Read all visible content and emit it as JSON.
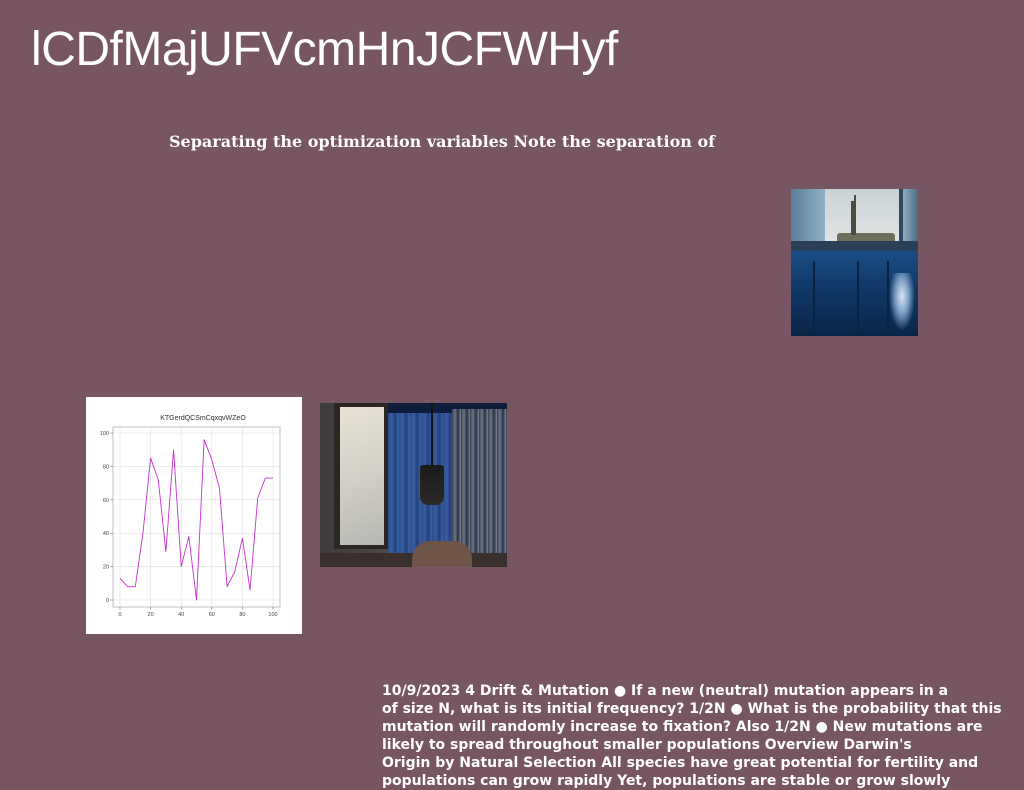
{
  "page": {
    "title": "lCDfMajUFVcmHnJCFWHyf",
    "subtitle": "Separating the optimization variables Note the separation of",
    "body_text": "10/9/2023 4 Drift & Mutation ● If a new (neutral) mutation appears in a\nof size N, what is its initial frequency? 1/2N ● What is the probability that this\nmutation will randomly increase to fixation? Also 1/2N ● New mutations are\nlikely to spread throughout smaller populations Overview Darwin's\nOrigin by Natural Selection All species have great potential for fertility and\npopulations can grow rapidly Yet, populations are stable or grow slowly",
    "background_color": "#775563",
    "text_color": "#ffffff"
  },
  "chart_data": {
    "type": "line",
    "title": "KTGerdQCSmCqxqvWZeO",
    "xlabel": "",
    "ylabel": "",
    "x": [
      0,
      5,
      10,
      15,
      20,
      25,
      30,
      35,
      40,
      45,
      50,
      55,
      60,
      65,
      70,
      75,
      80,
      85,
      90,
      95,
      100
    ],
    "series": [
      {
        "values": [
          13,
          8,
          8,
          40,
          85,
          72,
          29,
          90,
          20,
          38,
          0,
          96,
          84,
          67,
          8,
          17,
          37,
          6,
          61,
          73,
          73
        ],
        "color": "#c92fd0"
      }
    ],
    "xlim": [
      0,
      100
    ],
    "ylim": [
      0,
      100
    ],
    "xticks": [
      "0",
      "20",
      "40",
      "60",
      "80",
      "100"
    ],
    "yticks": [
      "0",
      "20",
      "40",
      "60",
      "80",
      "100"
    ],
    "grid": true
  }
}
